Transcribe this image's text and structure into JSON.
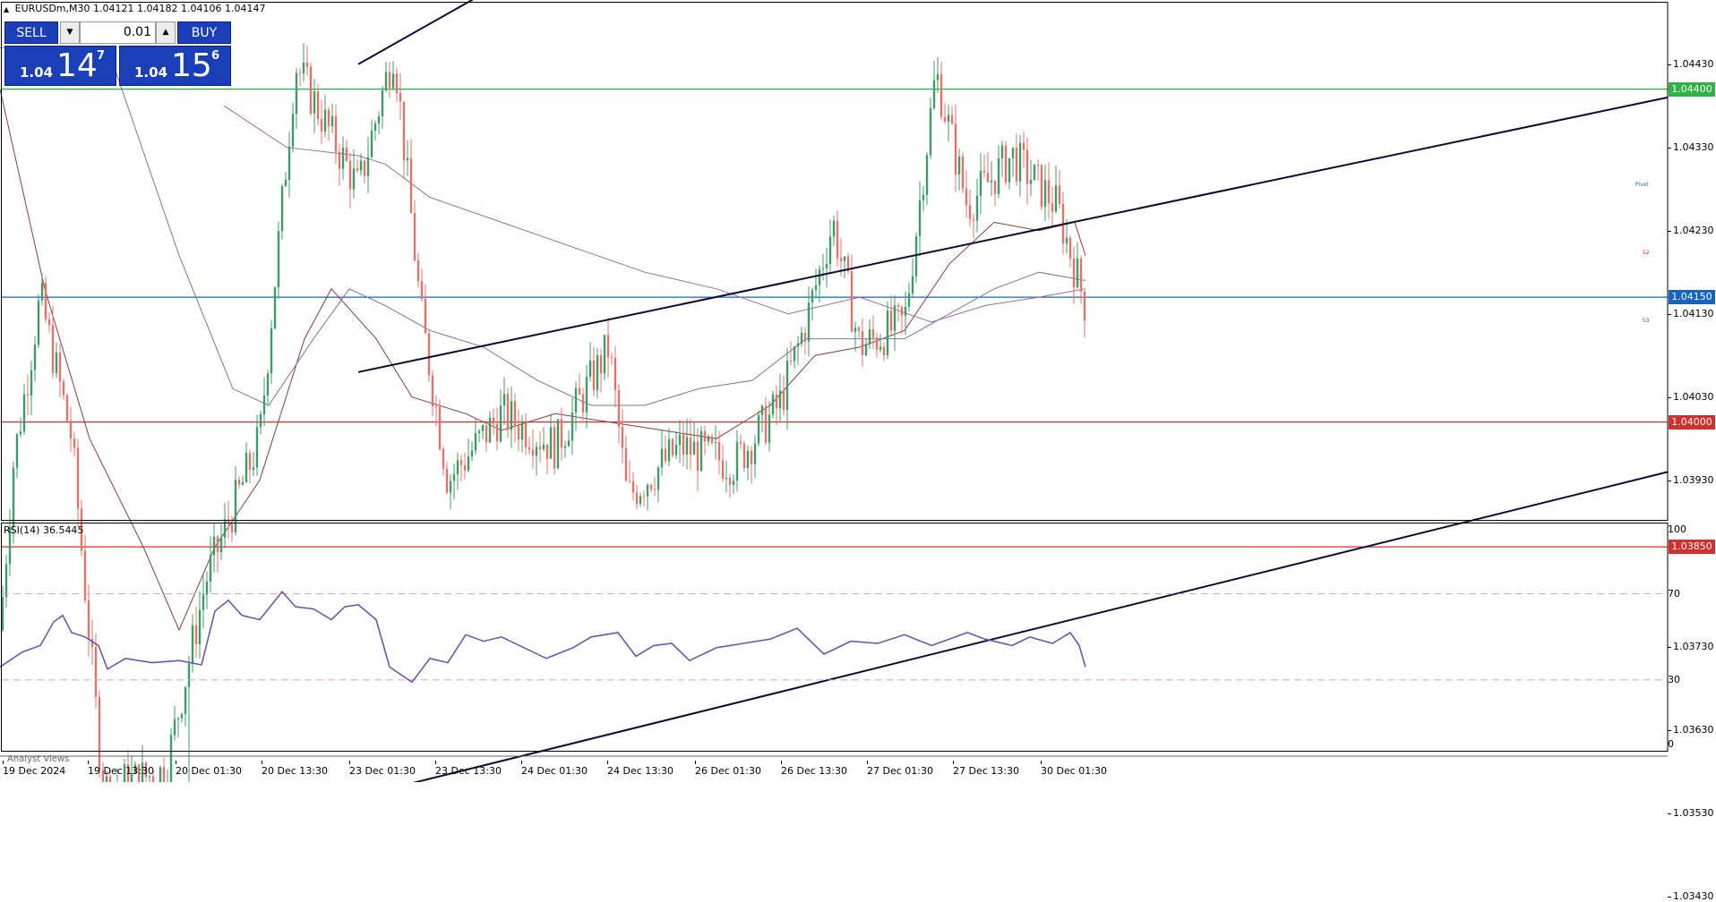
{
  "header": {
    "symbol": "EURUSDm,M30",
    "open": "1.04121",
    "high": "1.04182",
    "low": "1.04106",
    "close": "1.04147"
  },
  "trade_panel": {
    "sell_label": "SELL",
    "buy_label": "BUY",
    "lot": "0.01",
    "sell_prefix": "1.04",
    "sell_big": "14",
    "sell_sup": "7",
    "buy_prefix": "1.04",
    "buy_big": "15",
    "buy_sup": "6",
    "down_arrow_icon": "triangle-down-icon",
    "up_arrow_icon": "triangle-up-icon"
  },
  "price_tags": [
    {
      "label": "1.04400",
      "price": 1.044,
      "color": "#2fb344"
    },
    {
      "label": "1.04150",
      "price": 1.0415,
      "color": "#1565c0"
    },
    {
      "label": "1.04000",
      "price": 1.04,
      "color": "#d32f2f"
    },
    {
      "label": "1.03850",
      "price": 1.0385,
      "color": "#d32f2f"
    }
  ],
  "level_tags": {
    "pivot": "Pivot",
    "s2": "S2",
    "s3": "S3"
  },
  "chart_data": [
    {
      "type": "candlestick",
      "title": "EURUSDm,M30",
      "y_ticks": [
        "1.04430",
        "1.04330",
        "1.04230",
        "1.04130",
        "1.04030",
        "1.03930",
        "1.03730",
        "1.03630",
        "1.03530",
        "1.03430"
      ],
      "y_tick_values": [
        1.0443,
        1.0433,
        1.0423,
        1.0413,
        1.0403,
        1.0393,
        1.0373,
        1.0363,
        1.0353,
        1.0343
      ],
      "ylim": [
        1.0337,
        1.0455
      ],
      "x_tick_labels": [
        "19 Dec 2024",
        "19 Dec 13:30",
        "20 Dec 01:30",
        "20 Dec 13:30",
        "23 Dec 01:30",
        "23 Dec 13:30",
        "24 Dec 01:30",
        "24 Dec 13:30",
        "26 Dec 01:30",
        "26 Dec 13:30",
        "27 Dec 01:30",
        "27 Dec 13:30",
        "30 Dec 01:30"
      ],
      "horizontal_levels": [
        {
          "price": 1.044,
          "color": "#2fb344"
        },
        {
          "price": 1.0415,
          "color": "#1565c0"
        },
        {
          "price": 1.04,
          "color": "#d32f2f"
        },
        {
          "price": 1.0385,
          "color": "#d32f2f"
        }
      ],
      "candle_colors": {
        "up": "#3f9a6a",
        "down": "#e0736a"
      },
      "anchor_path": [
        [
          0,
          1.0375
        ],
        [
          15,
          1.0395
        ],
        [
          45,
          1.0415
        ],
        [
          80,
          1.0398
        ],
        [
          115,
          1.0356
        ],
        [
          185,
          1.0358
        ],
        [
          230,
          1.0381
        ],
        [
          290,
          1.0398
        ],
        [
          330,
          1.0443
        ],
        [
          400,
          1.0428
        ],
        [
          440,
          1.0445
        ],
        [
          470,
          1.0413
        ],
        [
          500,
          1.0393
        ],
        [
          560,
          1.0401
        ],
        [
          620,
          1.0397
        ],
        [
          680,
          1.0409
        ],
        [
          700,
          1.0391
        ],
        [
          760,
          1.0397
        ],
        [
          820,
          1.0395
        ],
        [
          870,
          1.0402
        ],
        [
          900,
          1.0412
        ],
        [
          930,
          1.0424
        ],
        [
          960,
          1.0409
        ],
        [
          1010,
          1.0412
        ],
        [
          1045,
          1.0442
        ],
        [
          1080,
          1.0426
        ],
        [
          1130,
          1.0432
        ],
        [
          1180,
          1.0426
        ],
        [
          1212,
          1.0414
        ]
      ],
      "lower_wicks": [
        [
          210,
          1.0348
        ]
      ],
      "moving_averages": [
        {
          "color": "#8b3a3a",
          "points": [
            [
              0,
              1.044
            ],
            [
              50,
              1.0416
            ],
            [
              100,
              1.0398
            ],
            [
              160,
              1.0385
            ],
            [
              200,
              1.0375
            ],
            [
              240,
              1.0385
            ],
            [
              290,
              1.0393
            ],
            [
              340,
              1.041
            ],
            [
              370,
              1.0416
            ],
            [
              420,
              1.041
            ],
            [
              460,
              1.0403
            ],
            [
              520,
              1.0401
            ],
            [
              560,
              1.0399
            ],
            [
              620,
              1.0401
            ],
            [
              680,
              1.04
            ],
            [
              740,
              1.0399
            ],
            [
              800,
              1.0398
            ],
            [
              860,
              1.0402
            ],
            [
              910,
              1.0408
            ],
            [
              960,
              1.0409
            ],
            [
              1010,
              1.0411
            ],
            [
              1060,
              1.0419
            ],
            [
              1110,
              1.0424
            ],
            [
              1160,
              1.0423
            ],
            [
              1200,
              1.0424
            ],
            [
              1212,
              1.042
            ]
          ]
        },
        {
          "color": "#7a6fb0",
          "points": [
            [
              0,
              1.0445
            ],
            [
              120,
              1.0445
            ],
            [
              200,
              1.042
            ],
            [
              260,
              1.0404
            ],
            [
              300,
              1.0402
            ],
            [
              350,
              1.041
            ],
            [
              390,
              1.0416
            ],
            [
              430,
              1.0414
            ],
            [
              480,
              1.0411
            ],
            [
              540,
              1.0409
            ],
            [
              600,
              1.0405
            ],
            [
              660,
              1.0402
            ],
            [
              720,
              1.0402
            ],
            [
              780,
              1.0404
            ],
            [
              840,
              1.0405
            ],
            [
              900,
              1.041
            ],
            [
              960,
              1.041
            ],
            [
              1010,
              1.041
            ],
            [
              1060,
              1.0413
            ],
            [
              1110,
              1.0416
            ],
            [
              1160,
              1.0418
            ],
            [
              1212,
              1.0417
            ]
          ]
        },
        {
          "color": "#9b6aa8",
          "points": [
            [
              250,
              1.0438
            ],
            [
              320,
              1.0433
            ],
            [
              400,
              1.0432
            ],
            [
              430,
              1.0431
            ],
            [
              480,
              1.0427
            ],
            [
              560,
              1.0424
            ],
            [
              640,
              1.0421
            ],
            [
              720,
              1.0418
            ],
            [
              800,
              1.0416
            ],
            [
              880,
              1.0413
            ],
            [
              960,
              1.0415
            ],
            [
              1040,
              1.0412
            ],
            [
              1100,
              1.0414
            ],
            [
              1160,
              1.0415
            ],
            [
              1212,
              1.0416
            ]
          ]
        }
      ],
      "trend_lines": [
        {
          "x1": 400,
          "y1": 1.0443,
          "x2": 795,
          "y2": 1.0467
        },
        {
          "x1": 400,
          "y1": 1.0406,
          "x2": 1862,
          "y2": 1.0439
        },
        {
          "x1": 400,
          "y1": 1.0355,
          "x2": 1862,
          "y2": 1.0394
        }
      ]
    },
    {
      "type": "line",
      "title": "RSI(14) 36.5445",
      "ylim": [
        0,
        100
      ],
      "y_ticks": [
        "100",
        "70",
        "30",
        "0"
      ],
      "y_tick_values": [
        100,
        70,
        30,
        0
      ],
      "levels": [
        70,
        30
      ],
      "series": [
        {
          "color": "#6a55b5",
          "points": [
            [
              0,
              36
            ],
            [
              25,
              43
            ],
            [
              45,
              46
            ],
            [
              60,
              57
            ],
            [
              70,
              60
            ],
            [
              80,
              52
            ],
            [
              95,
              50
            ],
            [
              110,
              46
            ],
            [
              120,
              35
            ],
            [
              140,
              40
            ],
            [
              170,
              38
            ],
            [
              200,
              39
            ],
            [
              225,
              37
            ],
            [
              240,
              62
            ],
            [
              255,
              67
            ],
            [
              270,
              60
            ],
            [
              290,
              58
            ],
            [
              315,
              71
            ],
            [
              330,
              64
            ],
            [
              350,
              63
            ],
            [
              370,
              58
            ],
            [
              385,
              64
            ],
            [
              400,
              65
            ],
            [
              420,
              58
            ],
            [
              435,
              36
            ],
            [
              460,
              29
            ],
            [
              480,
              40
            ],
            [
              500,
              38
            ],
            [
              520,
              51
            ],
            [
              540,
              48
            ],
            [
              560,
              50
            ],
            [
              590,
              44
            ],
            [
              610,
              40
            ],
            [
              640,
              45
            ],
            [
              660,
              50
            ],
            [
              690,
              52
            ],
            [
              710,
              41
            ],
            [
              730,
              46
            ],
            [
              750,
              47
            ],
            [
              770,
              39
            ],
            [
              800,
              45
            ],
            [
              830,
              47
            ],
            [
              860,
              49
            ],
            [
              890,
              54
            ],
            [
              920,
              42
            ],
            [
              950,
              48
            ],
            [
              980,
              47
            ],
            [
              1010,
              51
            ],
            [
              1040,
              46
            ],
            [
              1060,
              49
            ],
            [
              1080,
              52
            ],
            [
              1100,
              49
            ],
            [
              1130,
              46
            ],
            [
              1150,
              50
            ],
            [
              1175,
              47
            ],
            [
              1195,
              52
            ],
            [
              1205,
              46
            ],
            [
              1212,
              36
            ]
          ]
        }
      ]
    }
  ],
  "rsi_title": "RSI(14) 36.5445",
  "tab_label": "Analyst Views"
}
